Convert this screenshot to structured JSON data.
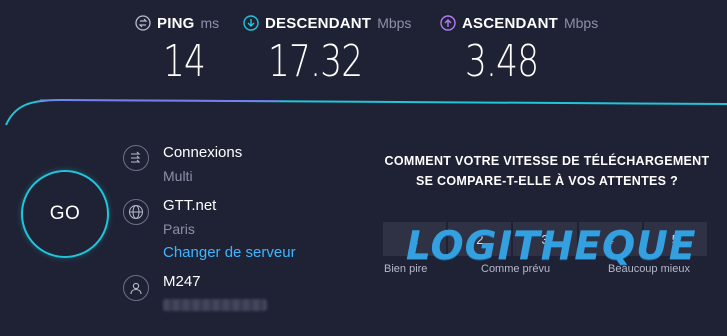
{
  "metrics": {
    "ping": {
      "label": "PING",
      "unit": "ms",
      "value": "14"
    },
    "download": {
      "label": "DESCENDANT",
      "unit": "Mbps",
      "value": "17.32"
    },
    "upload": {
      "label": "ASCENDANT",
      "unit": "Mbps",
      "value": "3.48"
    }
  },
  "go_label": "GO",
  "connections": {
    "title": "Connexions",
    "mode": "Multi"
  },
  "server": {
    "name": "GTT.net",
    "city": "Paris",
    "change_label": "Changer de serveur"
  },
  "provider": {
    "name": "M247"
  },
  "question": {
    "text": "COMMENT VOTRE VITESSE DE TÉLÉCHARGEMENT SE COMPARE-T-ELLE À VOS ATTENTES ?",
    "ratings": [
      "1",
      "2",
      "3",
      "4",
      "5"
    ],
    "left_label": "Bien pire",
    "mid_label": "Comme prévu",
    "right_label": "Beaucoup mieux"
  },
  "watermark": "LOGITHEQUE",
  "colors": {
    "accent": "#21c4d8",
    "upload": "#b27cf5",
    "link": "#3eb6ff"
  }
}
